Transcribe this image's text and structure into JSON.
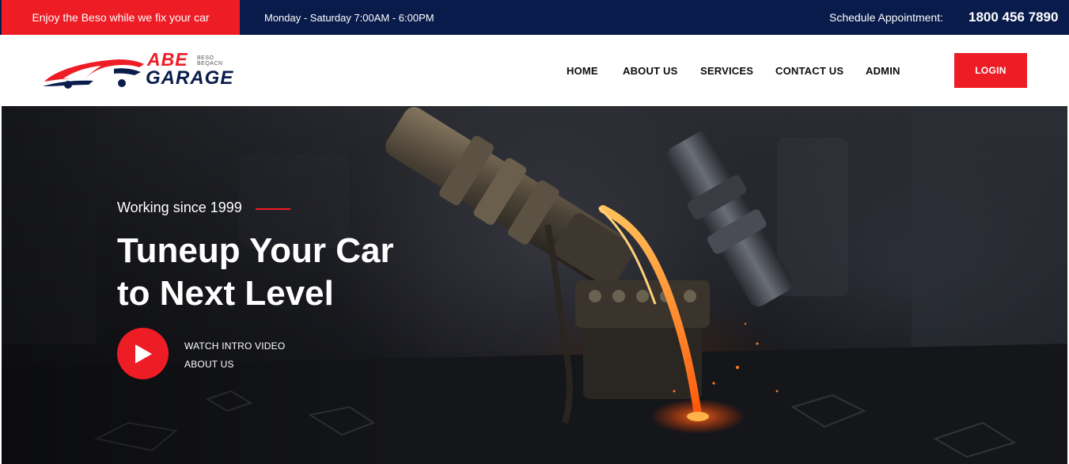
{
  "topbar": {
    "promo": "Enjoy the Beso while we fix your car",
    "hours": "Monday - Saturday 7:00AM - 6:00PM",
    "schedule_label": "Schedule Appointment:",
    "phone": "1800 456 7890"
  },
  "logo": {
    "word1": "ABE",
    "tagline": "BESO BEQACN",
    "word2": "GARAGE"
  },
  "nav": {
    "items": [
      "HOME",
      "ABOUT US",
      "SERVICES",
      "CONTACT US",
      "ADMIN"
    ],
    "login": "LOGIN"
  },
  "hero": {
    "kicker": "Working since 1999",
    "headline_line1": "Tuneup Your Car",
    "headline_line2": "to Next Level",
    "watch_video": "WATCH INTRO VIDEO",
    "about_us": "ABOUT US"
  },
  "colors": {
    "accent": "#ee1c25",
    "navy": "#081b4b"
  },
  "icons": {
    "play": "play-icon",
    "logo": "car-logo-icon"
  }
}
